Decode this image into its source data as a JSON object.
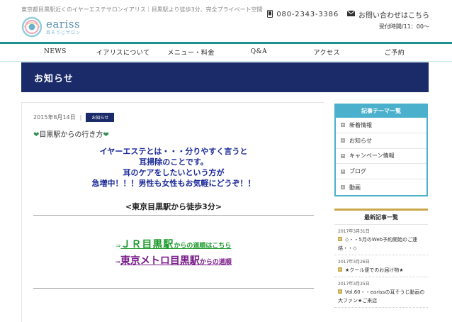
{
  "header": {
    "tagline": "東京都目黒駅近くのイヤーエステサロンイアリス｜目黒駅より徒歩3分、完全プライベート空間",
    "logo_name": "eariss",
    "logo_sub": "耳そうじサロン",
    "phone_icon": "phone-icon",
    "phone": "080-2343-3386",
    "mail_icon": "mail-icon",
    "contact_label": "お問い合わせはこちら",
    "hours": "受付時間/11：00～"
  },
  "nav": {
    "items": [
      "NEWS",
      "イアリスについて",
      "メニュー・料金",
      "Q&A",
      "アクセス",
      "ご予約"
    ]
  },
  "page_title": "お知らせ",
  "post": {
    "date": "2015年8月14日",
    "separator": "|",
    "category": "お知らせ",
    "heart": "❤",
    "title": "目黒駅からの行き方",
    "lead": [
      "イヤーエステとは・・・分りやすく言うと",
      "耳掃除のことです。",
      "耳のケアをしたいという方が",
      "急増中！！！男性も女性もお気軽にどうぞ！！"
    ],
    "subhead": "<東京目黒駅から徒歩3分>",
    "jr_arrow": "⇒",
    "jr_big": "ＪＲ目黒駅",
    "jr_small": "からの道順はこちら",
    "metro_arrow": "⇒",
    "metro_big": "東京メトロ目黒駅",
    "metro_small": "からの道順"
  },
  "sidebar": {
    "themes_title": "記事テーマ一覧",
    "themes": [
      "新着情報",
      "お知らせ",
      "キャンペーン情報",
      "ブログ",
      "動画"
    ],
    "recent_title": "最新記事一覧",
    "recent": [
      {
        "date": "2017年3月31日",
        "title": "◇・・5月のWeb予約開始のご連絡・・◇"
      },
      {
        "date": "2017年3月26日",
        "title": "★クール便でのお届け物★"
      },
      {
        "date": "2017年3月25日",
        "title": "Vol.60・・earissの耳そうじ動画の大ファン★ご来店"
      }
    ]
  },
  "colors": {
    "navy": "#1b2a68",
    "teal": "#1e8f8e",
    "sidebar_blue": "#4bb0cc",
    "gold": "#c9a84a",
    "lead_blue": "#1b2a9a",
    "jr_green": "#1a9a2a",
    "metro_purple": "#7a1d8a"
  }
}
